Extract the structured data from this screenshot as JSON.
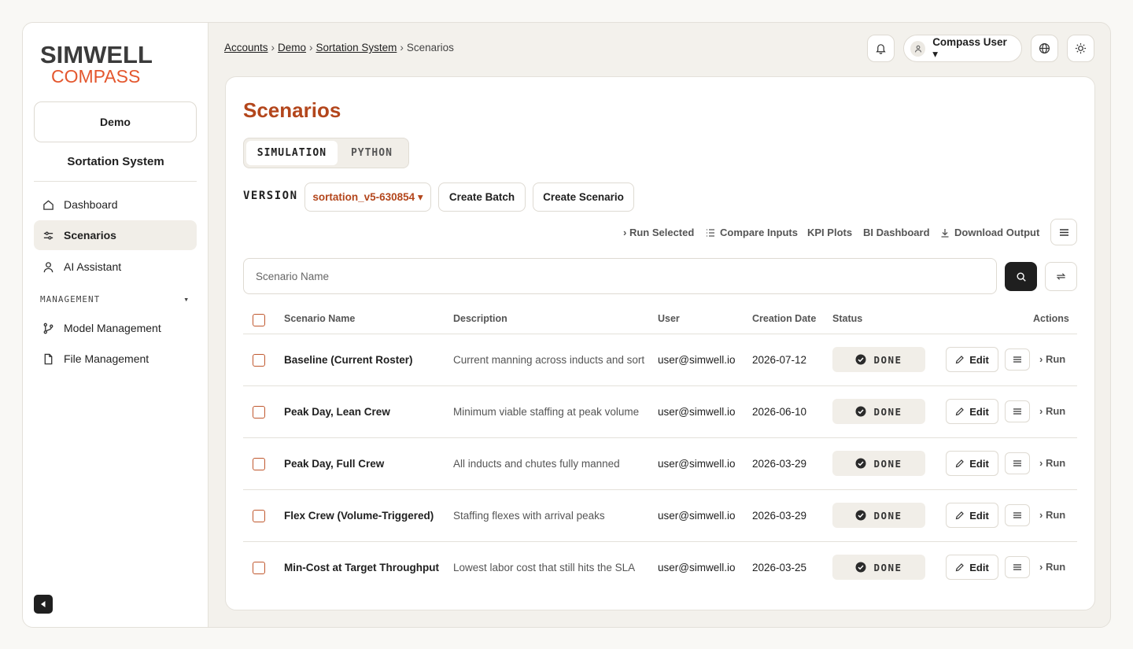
{
  "logo": {
    "top": "SIMWELL",
    "bottom": "COMPASS"
  },
  "sidebar": {
    "account": "Demo",
    "project": "Sortation System",
    "items": [
      {
        "label": "Dashboard",
        "icon": "home-icon"
      },
      {
        "label": "Scenarios",
        "icon": "sliders-icon"
      },
      {
        "label": "AI Assistant",
        "icon": "person-icon"
      }
    ],
    "section_label": "MANAGEMENT",
    "section_caret": "▾",
    "management_items": [
      {
        "label": "Model Management",
        "icon": "branch-icon"
      },
      {
        "label": "File Management",
        "icon": "file-icon"
      }
    ]
  },
  "breadcrumb": {
    "items": [
      "Accounts",
      "Demo",
      "Sortation System",
      "Scenarios"
    ],
    "separator": "›"
  },
  "header": {
    "user": "Compass User ▾"
  },
  "main": {
    "title": "Scenarios",
    "tabs": [
      "SIMULATION",
      "PYTHON"
    ],
    "version_label": "VERSION",
    "version_value": "sortation_v5-630854 ▾",
    "create_batch": "Create Batch",
    "create_scenario": "Create Scenario",
    "toolbar": {
      "run_selected": "› Run Selected",
      "compare_inputs": "Compare Inputs",
      "kpi_plots": "KPI Plots",
      "bi_dashboard": "BI Dashboard",
      "download_output": "Download Output"
    },
    "search_placeholder": "Scenario Name"
  },
  "table": {
    "headers": [
      "Scenario Name",
      "Description",
      "User",
      "Creation Date",
      "Status",
      "Actions"
    ],
    "edit_label": "Edit",
    "run_label": "› Run",
    "rows": [
      {
        "name": "Baseline (Current Roster)",
        "description": "Current manning across inducts and sort",
        "user": "user@simwell.io",
        "date": "2026-07-12",
        "status": "DONE"
      },
      {
        "name": "Peak Day, Lean Crew",
        "description": "Minimum viable staffing at peak volume",
        "user": "user@simwell.io",
        "date": "2026-06-10",
        "status": "DONE"
      },
      {
        "name": "Peak Day, Full Crew",
        "description": "All inducts and chutes fully manned",
        "user": "user@simwell.io",
        "date": "2026-03-29",
        "status": "DONE"
      },
      {
        "name": "Flex Crew (Volume-Triggered)",
        "description": "Staffing flexes with arrival peaks",
        "user": "user@simwell.io",
        "date": "2026-03-29",
        "status": "DONE"
      },
      {
        "name": "Min-Cost at Target Throughput",
        "description": "Lowest labor cost that still hits the SLA",
        "user": "user@simwell.io",
        "date": "2026-03-25",
        "status": "DONE"
      }
    ]
  },
  "colors": {
    "accent": "#b3461c",
    "logo_orange": "#e4572e",
    "dark": "#1f1f1f"
  }
}
